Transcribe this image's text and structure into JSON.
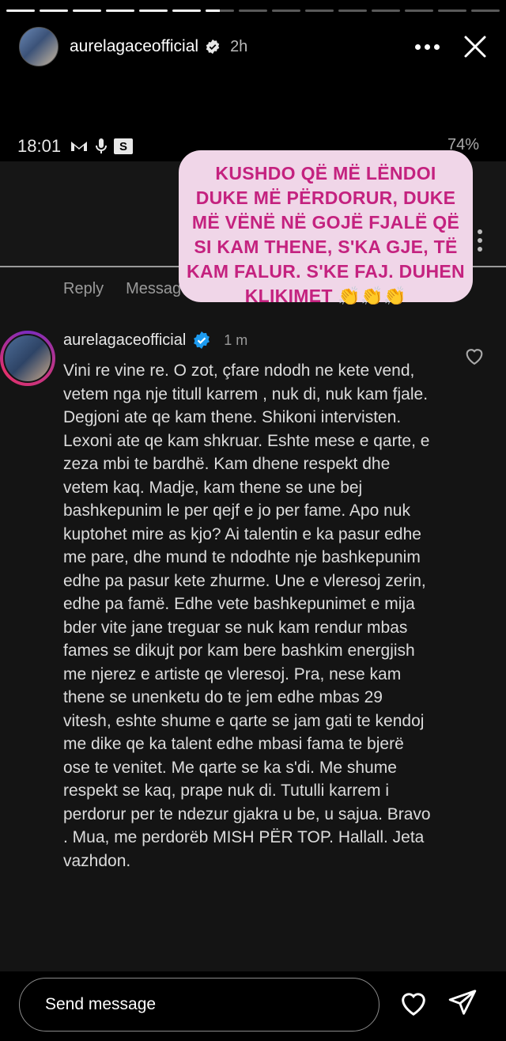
{
  "progress": {
    "total": 15,
    "done": 6,
    "active_fill": 0.5
  },
  "header": {
    "username": "aurelagaceofficial",
    "time": "2h"
  },
  "status_bar": {
    "clock": "18:01",
    "icon_letter": "S",
    "battery": "74%"
  },
  "sticker": {
    "text": "KUSHDO QË  MË LËNDOI DUKE MË PËRDORUR, DUKE MË VËNË NË GOJË FJALË QË SI KAM THENE, S'KA GJE, TË KAM FALUR. S'KE FAJ. DUHEN KLIKIMET 👏👏👏"
  },
  "reply_row": {
    "reply": "Reply",
    "message": "Message"
  },
  "comment": {
    "username": "aurelagaceofficial",
    "time": "1 m",
    "text": "Vini re vine re. O zot, çfare ndodh ne kete vend, vetem nga nje titull karrem , nuk di, nuk kam fjale.  Degjoni ate qe kam thene. Shikoni intervisten.   Lexoni ate qe kam shkruar.  Eshte mese e qarte, e zeza mbi te bardhë.   Kam dhene respekt dhe vetem kaq.  Madje,  kam thene se une bej bashkepunim le per qejf e jo per fame.  Apo nuk kuptohet mire as kjo?   Ai talentin e ka pasur edhe me pare,   dhe mund te ndodhte nje bashkepunim edhe pa pasur kete zhurme. Une e vleresoj zerin, edhe pa famë.  Edhe vete bashkepunimet  e mija bder vite jane treguar se nuk kam rendur mbas  fames se dikujt por kam bere bashkim energjish me njerez e artiste qe vleresoj.   Pra, nese kam thene se unenketu do te jem edhe mbas 29 vitesh, eshte shume e qarte se  jam gati te kendoj me  dike qe ka talent edhe mbasi fama te bjerë ose te venitet. Me qarte se ka s'di. Me shume respekt se kaq, prape nuk di.   Tutulli karrem i perdorur per te ndezur gjakra u be, u sajua.  Bravo .  Mua, me perdorëb MISH PËR TOP.  Hallall.  Jeta vazhdon."
  },
  "footer": {
    "placeholder": "Send message"
  },
  "icons": [
    "verified-icon",
    "more-icon",
    "close-icon",
    "heart-icon",
    "send-icon"
  ]
}
